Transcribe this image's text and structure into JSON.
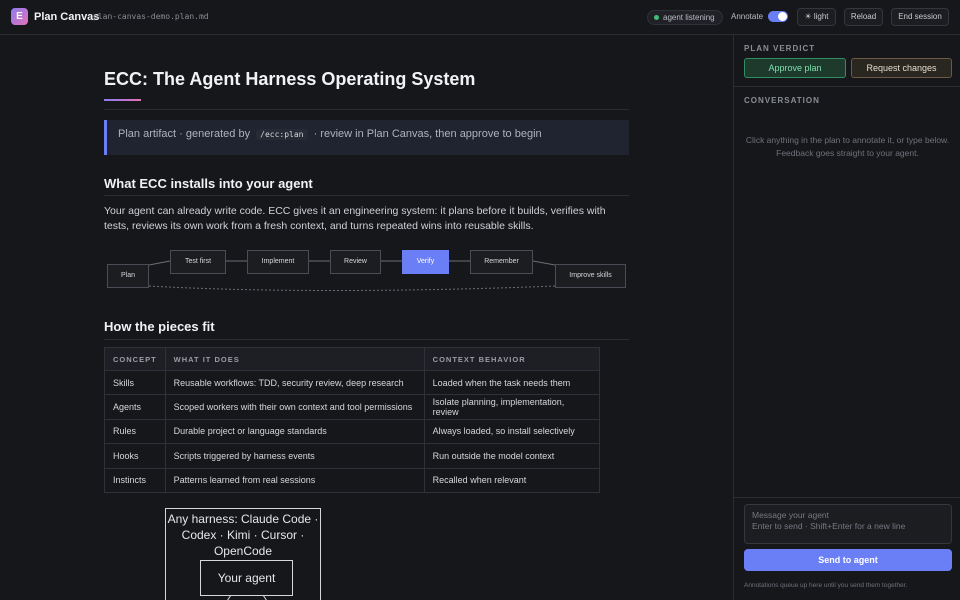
{
  "header": {
    "logo_letter": "E",
    "title": "Plan Canvas",
    "file": "plan-canvas-demo.plan.md",
    "status": "agent listening",
    "annotate_label": "Annotate",
    "annotate_on": true,
    "theme_label": "☀ light",
    "reload_label": "Reload",
    "end_label": "End session"
  },
  "doc": {
    "title": "ECC: The Agent Harness Operating System",
    "callout": {
      "before": "Plan artifact · generated by",
      "code": "/ecc:plan",
      "after": "· review in Plan Canvas, then approve to begin"
    },
    "section1_title": "What ECC installs into your agent",
    "section1_text": "Your agent can already write code. ECC gives it an engineering system: it plans before it builds, verifies with tests, reviews its own work from a fresh context, and turns repeated wins into reusable skills.",
    "flow_nodes": [
      "Plan",
      "Test first",
      "Implement",
      "Review",
      "Verify",
      "Remember",
      "Improve skills"
    ],
    "section2_title": "How the pieces fit",
    "table": {
      "headers": [
        "CONCEPT",
        "WHAT IT DOES",
        "CONTEXT BEHAVIOR"
      ],
      "rows": [
        [
          "Skills",
          "Reusable workflows: TDD, security review, deep research",
          "Loaded when the task needs them"
        ],
        [
          "Agents",
          "Scoped workers with their own context and tool permissions",
          "Isolate planning, implementation, review"
        ],
        [
          "Rules",
          "Durable project or language standards",
          "Always loaded, so install selectively"
        ],
        [
          "Hooks",
          "Scripts triggered by harness events",
          "Run outside the model context"
        ],
        [
          "Instincts",
          "Patterns learned from real sessions",
          "Recalled when relevant"
        ]
      ]
    },
    "diagram": {
      "harness_label": "Any harness: Claude Code · Codex · Kimi · Cursor · OpenCode",
      "agent_label": "Your agent"
    }
  },
  "sidebar": {
    "verdict_label": "PLAN VERDICT",
    "approve_label": "Approve plan",
    "request_label": "Request changes",
    "conversation_label": "CONVERSATION",
    "empty_hint": "Click anything in the plan to annotate it, or type below. Feedback goes straight to your agent.",
    "message_placeholder": "Message your agent\nEnter to send · Shift+Enter for a new line",
    "send_label": "Send to agent",
    "footer": "Annotations queue up here until you send them together."
  },
  "colors": {
    "accent": "#6a7ef5",
    "approve": "#7fe0ad",
    "status_dot": "#3fbf78",
    "background": "#16171b"
  }
}
